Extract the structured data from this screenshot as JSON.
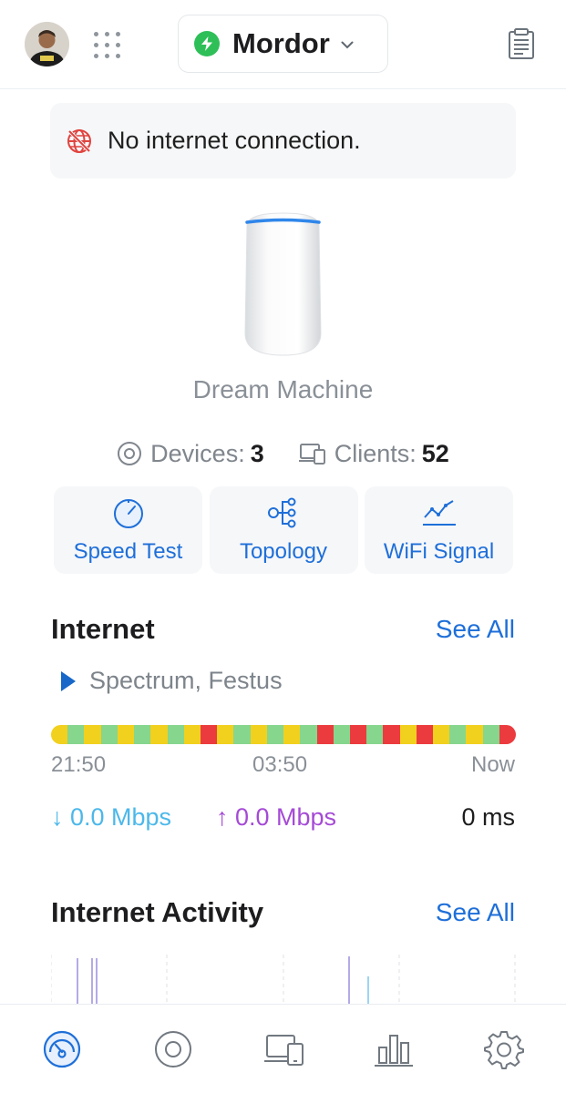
{
  "header": {
    "site_name": "Mordor",
    "site_status": "online",
    "icons": [
      "avatar",
      "apps-grid-icon",
      "chevron-down-icon",
      "notes-icon"
    ]
  },
  "banner": {
    "icon": "no-internet-globe-icon",
    "text": "No internet connection.",
    "icon_color": "#e0443f"
  },
  "device": {
    "name": "Dream Machine",
    "devices_label": "Devices:",
    "devices_count": "3",
    "clients_label": "Clients:",
    "clients_count": "52"
  },
  "actions": [
    {
      "label": "Speed Test",
      "icon": "speedometer-icon"
    },
    {
      "label": "Topology",
      "icon": "topology-icon"
    },
    {
      "label": "WiFi Signal",
      "icon": "wifi-signal-chart-icon"
    }
  ],
  "internet": {
    "title": "Internet",
    "see_all": "See All",
    "isp": "Spectrum, Festus",
    "uptime_colors": {
      "good": "#86d68e",
      "warn": "#f2d01e",
      "down": "#ec3b3e"
    },
    "uptime_segments": [
      "warn",
      "good",
      "warn",
      "good",
      "warn",
      "good",
      "warn",
      "good",
      "warn",
      "down",
      "warn",
      "good",
      "warn",
      "good",
      "warn",
      "good",
      "down",
      "good",
      "down",
      "good",
      "down",
      "warn",
      "down",
      "warn",
      "good",
      "warn",
      "good",
      "down"
    ],
    "time_labels": {
      "start": "21:50",
      "mid": "03:50",
      "end": "Now"
    },
    "download": "↓ 0.0 Mbps",
    "upload": "↑ 0.0 Mbps",
    "latency": "0 ms",
    "colors": {
      "download": "#4cb8ea",
      "upload": "#a54ad6",
      "link": "#1e6fd9"
    }
  },
  "activity": {
    "title": "Internet Activity",
    "see_all": "See All"
  },
  "tabbar": {
    "items": [
      "dashboard-icon",
      "devices-icon",
      "clients-icon",
      "insights-icon",
      "settings-icon"
    ],
    "active": "dashboard-icon"
  }
}
